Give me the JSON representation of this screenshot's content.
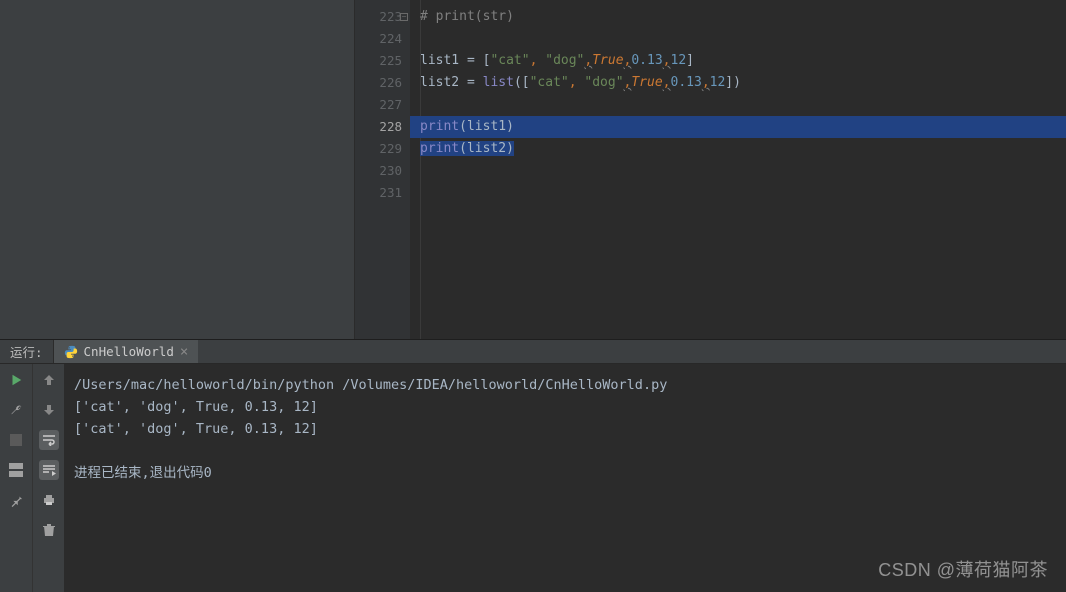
{
  "editor": {
    "lineNumbers": [
      "223",
      "224",
      "225",
      "226",
      "227",
      "228",
      "229",
      "230",
      "231"
    ],
    "comment": "# print(str)",
    "l225": {
      "ident": "list1",
      "eq": " = ",
      "b1": "[",
      "s1": "\"cat\"",
      "c1": ", ",
      "s2": "\"dog\"",
      "sep1": ",",
      "true": "True",
      "sep2": ",",
      "n1": "0.13",
      "sep3": ",",
      "n2": "12",
      "b2": "]"
    },
    "l226": {
      "ident": "list2",
      "eq": " = ",
      "fn": "list",
      "p1": "([",
      "s1": "\"cat\"",
      "c1": ", ",
      "s2": "\"dog\"",
      "sep1": ",",
      "true": "True",
      "sep2": ",",
      "n1": "0.13",
      "sep3": ",",
      "n2": "12",
      "p2": "])"
    },
    "l228": {
      "fn": "print",
      "p1": "(",
      "arg": "list1",
      "p2": ")"
    },
    "l229": {
      "fn": "print",
      "p1": "(",
      "arg": "list2",
      "p2": ")"
    }
  },
  "runbar": {
    "label": "运行:",
    "tab_name": "CnHelloWorld"
  },
  "console": {
    "cmd": "/Users/mac/helloworld/bin/python /Volumes/IDEA/helloworld/CnHelloWorld.py",
    "out1": "['cat', 'dog', True, 0.13, 12]",
    "out2": "['cat', 'dog', True, 0.13, 12]",
    "exit": "进程已结束,退出代码0"
  },
  "watermark": "CSDN @薄荷猫阿茶"
}
